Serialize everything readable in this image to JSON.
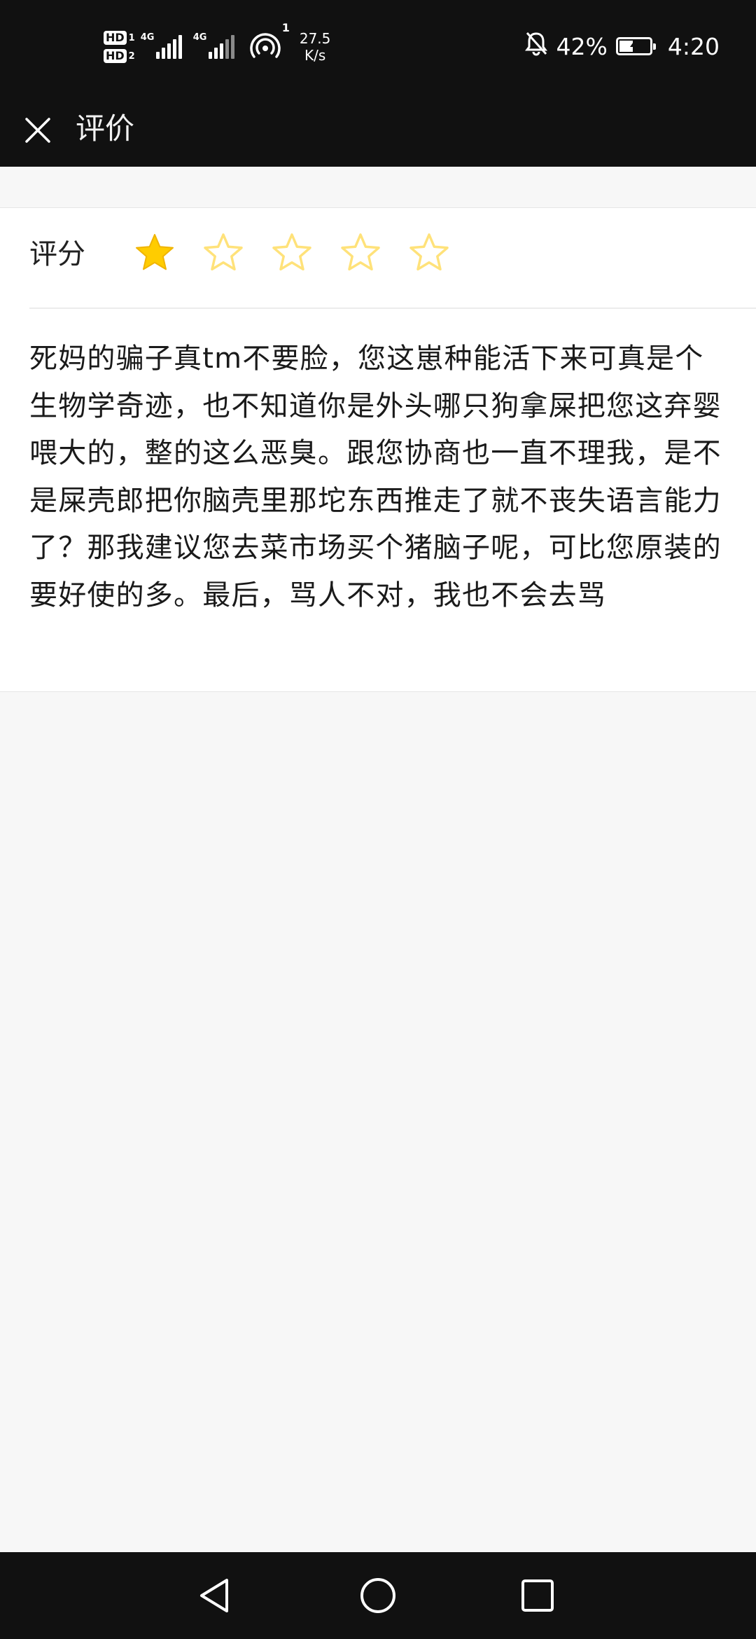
{
  "status_bar": {
    "hd1_label": "HD",
    "hd1_sub": "1",
    "hd2_label": "HD",
    "hd2_sub": "2",
    "signal1_type": "4G",
    "signal2_type": "4G",
    "hotspot_count": "1",
    "net_speed_value": "27.5",
    "net_speed_unit": "K/s",
    "battery_percent": "42%",
    "time": "4:20",
    "icons": [
      "hd-icon",
      "signal-icon",
      "hotspot-icon",
      "mute-bell-icon",
      "battery-charging-icon"
    ]
  },
  "app_bar": {
    "title": "评价",
    "close_icon": "close-icon"
  },
  "rating": {
    "label": "评分",
    "value": 1,
    "max": 5,
    "filled_color": "#ffcc00",
    "empty_color": "#ffe27a"
  },
  "review": {
    "text": "死妈的骗子真tm不要脸，您这崽种能活下来可真是个生物学奇迹，也不知道你是外头哪只狗拿屎把您这弃婴喂大的，整的这么恶臭。跟您协商也一直不理我，是不是屎壳郎把你脑壳里那坨东西推走了就不丧失语言能力了？那我建议您去菜市场买个猪脑子呢，可比您原装的要好使的多。最后，骂人不对，我也不会去骂"
  },
  "nav_bar": {
    "icons": [
      "back-triangle-icon",
      "home-circle-icon",
      "recents-square-icon"
    ]
  },
  "colors": {
    "bars_bg": "#111111",
    "page_bg": "#f7f7f7",
    "card_bg": "#ffffff"
  }
}
